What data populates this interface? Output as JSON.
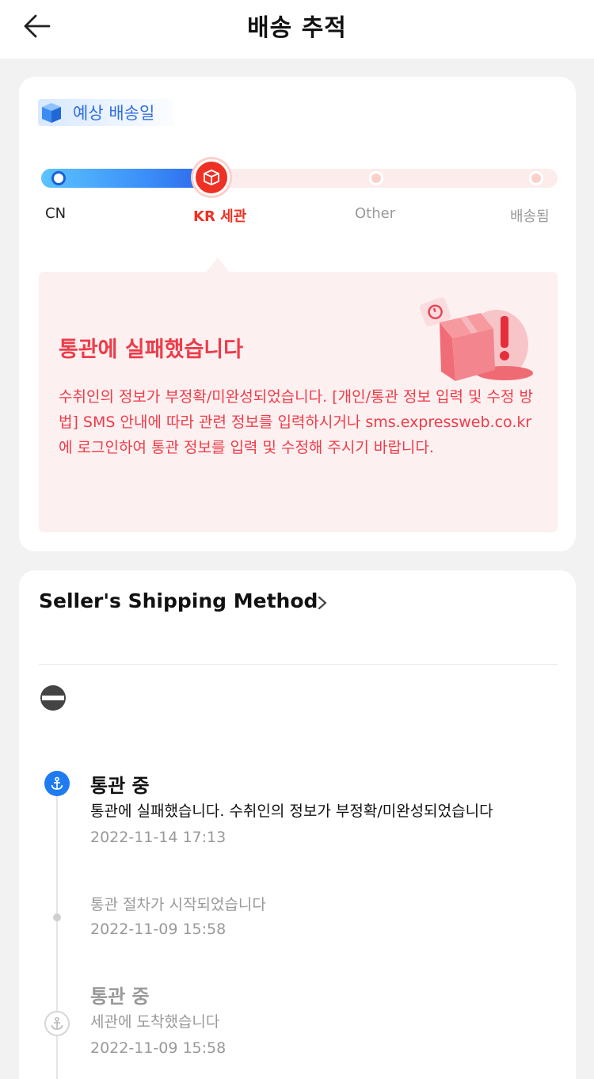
{
  "header": {
    "title": "배송 추적"
  },
  "estimate": {
    "label": "예상 배송일",
    "progress": {
      "current_index": 1,
      "stages": [
        "CN",
        "KR 세관",
        "Other",
        "배송됨"
      ]
    },
    "alert": {
      "title": "통관에 실패했습니다",
      "body": "수취인의 정보가 부정확/미완성되었습니다. [개인/통관 정보 입력 및 수정 방법] SMS 안내에 따라 관련 정보를 입력하시거나 sms.expressweb.co.kr에 로그인하여 통관 정보를 입력 및 수정해 주시기 바랍니다."
    }
  },
  "tracking": {
    "method_title": "Seller's Shipping Method",
    "events": [
      {
        "status": "통관 중",
        "description": "통관에 실패했습니다. 수취인의 정보가 부정확/미완성되었습니다",
        "time": "2022-11-14 17:13"
      },
      {
        "description": "통관 절차가 시작되었습니다",
        "time": "2022-11-09 15:58"
      },
      {
        "status": "통관 중",
        "description": "세관에 도착했습니다",
        "time": "2022-11-09 15:58"
      }
    ]
  },
  "colors": {
    "accent_red": "#ee3124",
    "alert_text": "#ee3c4a",
    "alert_bg": "#fdf0f0",
    "active_blue": "#1e7bf0",
    "label_blue": "#2f6de0"
  }
}
